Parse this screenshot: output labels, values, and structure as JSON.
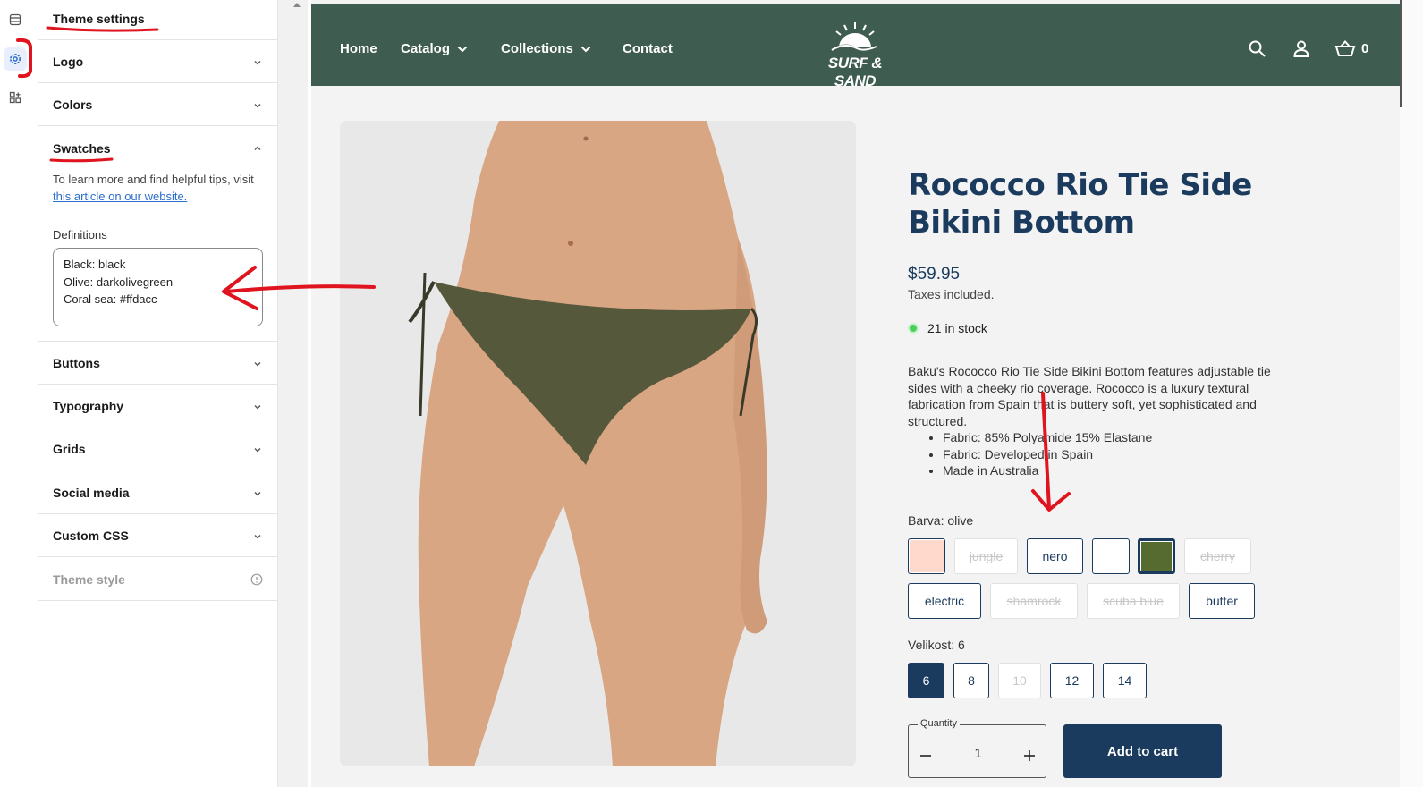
{
  "sidebar": {
    "heading": "Theme settings",
    "sections": [
      {
        "label": "Logo"
      },
      {
        "label": "Colors"
      },
      {
        "label": "Swatches"
      },
      {
        "label": "Buttons"
      },
      {
        "label": "Typography"
      },
      {
        "label": "Grids"
      },
      {
        "label": "Social media"
      },
      {
        "label": "Custom CSS"
      },
      {
        "label": "Theme style"
      }
    ],
    "swatches": {
      "help_text": "To learn more and find helpful tips, visit ",
      "help_link": "this article on our website.",
      "definitions_label": "Definitions",
      "definitions": [
        "Black: black",
        "Olive: darkolivegreen",
        "Coral sea: #ffdacc"
      ]
    }
  },
  "store": {
    "nav": {
      "home": "Home",
      "catalog": "Catalog",
      "collections": "Collections",
      "contact": "Contact",
      "logo_text": "SURF & SAND",
      "cart_count": "0"
    },
    "product": {
      "title": "Rococco Rio Tie Side Bikini Bottom",
      "price": "$59.95",
      "taxes": "Taxes included.",
      "stock": "21 in stock",
      "description": "Baku's Rococco Rio Tie Side Bikini Bottom features adjustable tie sides with a cheeky rio coverage. Rococco is a luxury textural fabrication from Spain that is buttery soft, yet sophisticated and structured.",
      "bullets": [
        "Fabric: 85% Polyamide 15% Elastane",
        "Fabric: Developed in Spain",
        "Made in Australia"
      ],
      "color_label": "Barva: olive",
      "colors": [
        {
          "label": "",
          "swatch": "#ffdacc"
        },
        {
          "label": "jungle"
        },
        {
          "label": "nero"
        },
        {
          "label": "",
          "swatch": "#ffffff"
        },
        {
          "label": "",
          "swatch": "#556b2f"
        },
        {
          "label": "cherry"
        },
        {
          "label": "electric"
        },
        {
          "label": "shamrock"
        },
        {
          "label": "scuba blue"
        },
        {
          "label": "butter"
        }
      ],
      "size_label": "Velikost: 6",
      "sizes": [
        "6",
        "8",
        "10",
        "12",
        "14"
      ],
      "quantity_label": "Quantity",
      "quantity": "1",
      "add_to_cart": "Add to cart"
    }
  },
  "colors": {
    "nav_bg": "#3f5c50",
    "brand_blue": "#1b3b5e",
    "annotation_red": "#e0141e"
  }
}
